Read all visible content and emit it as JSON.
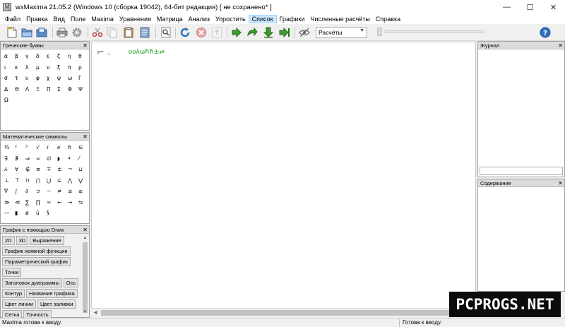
{
  "window": {
    "title": "wxMaxima 21.05.2 (Windows 10 (сборка 19042), 64-бит редакция) [ не сохранено* ]",
    "minimize_glyph": "—",
    "maximize_glyph": "☐",
    "close_glyph": "✕"
  },
  "menu": [
    "Файл",
    "Правка",
    "Вид",
    "Поле",
    "Maxima",
    "Уравнения",
    "Матрица",
    "Анализ",
    "Упростить",
    "Список",
    "Графики",
    "Численные расчёты",
    "Справка"
  ],
  "toolbar": {
    "mode_select": "Расчёты",
    "icons": [
      "new-document",
      "open-folder",
      "save",
      "print",
      "settings",
      "cut",
      "copy",
      "paste",
      "select-all",
      "find",
      "refresh",
      "stop",
      "interrupt",
      "step",
      "step-over",
      "step-into",
      "step-end",
      "hide",
      "help"
    ]
  },
  "greek_panel": {
    "title": "Греческие буквы",
    "symbols": [
      "α",
      "β",
      "γ",
      "δ",
      "ε",
      "ζ",
      "η",
      "θ",
      "ι",
      "κ",
      "λ",
      "μ",
      "ν",
      "ξ",
      "π",
      "ρ",
      "σ",
      "τ",
      "υ",
      "φ",
      "χ",
      "ψ",
      "ω",
      "Γ",
      "Δ",
      "Θ",
      "Λ",
      "Ξ",
      "Π",
      "Σ",
      "Φ",
      "Ψ",
      "Ω"
    ]
  },
  "math_panel": {
    "title": "Математические символы",
    "symbols": [
      "½",
      "²",
      "³",
      "√",
      "ⅈ",
      "ℯ",
      "ℏ",
      "∈",
      "∃",
      "∄",
      "⇒",
      "∞",
      "∅",
      "◗",
      "•",
      "⁄",
      "⅄",
      "∀",
      "∉",
      "≡",
      "∓",
      "±",
      "¬",
      "⊔",
      "⊥",
      "⊤",
      "⊓",
      "⋂",
      "⋃",
      "⊆",
      "⋀",
      "⋁",
      "∇",
      "∫",
      "∂",
      "⊃",
      "∼",
      "≠",
      "≤",
      "≥",
      "≫",
      "≪",
      "∑",
      "∏",
      "≈",
      "←",
      "→",
      "⇋",
      "—",
      "▮",
      "ø",
      "ü",
      "§"
    ]
  },
  "draw_panel": {
    "title": "График с помощью Draw",
    "buttons": [
      "2D",
      "3D",
      "Выражение",
      "График неявной функции",
      "Параметрический график",
      "Точки",
      "Заголовок диаграммы",
      "Ось",
      "Контур",
      "Название графика",
      "Цвет линии",
      "Цвет заливки",
      "Сетка",
      "Точность"
    ]
  },
  "worksheet": {
    "cell_prompt": "→",
    "cell_text": "υυλѡħħ±⇌"
  },
  "journal_panel": {
    "title": "Журнал"
  },
  "contents_panel": {
    "title": "Содержание"
  },
  "status": {
    "left": "Maxima готова к вводу.",
    "right": "Готова к вводу."
  },
  "watermark": "PCPROGS.NET"
}
